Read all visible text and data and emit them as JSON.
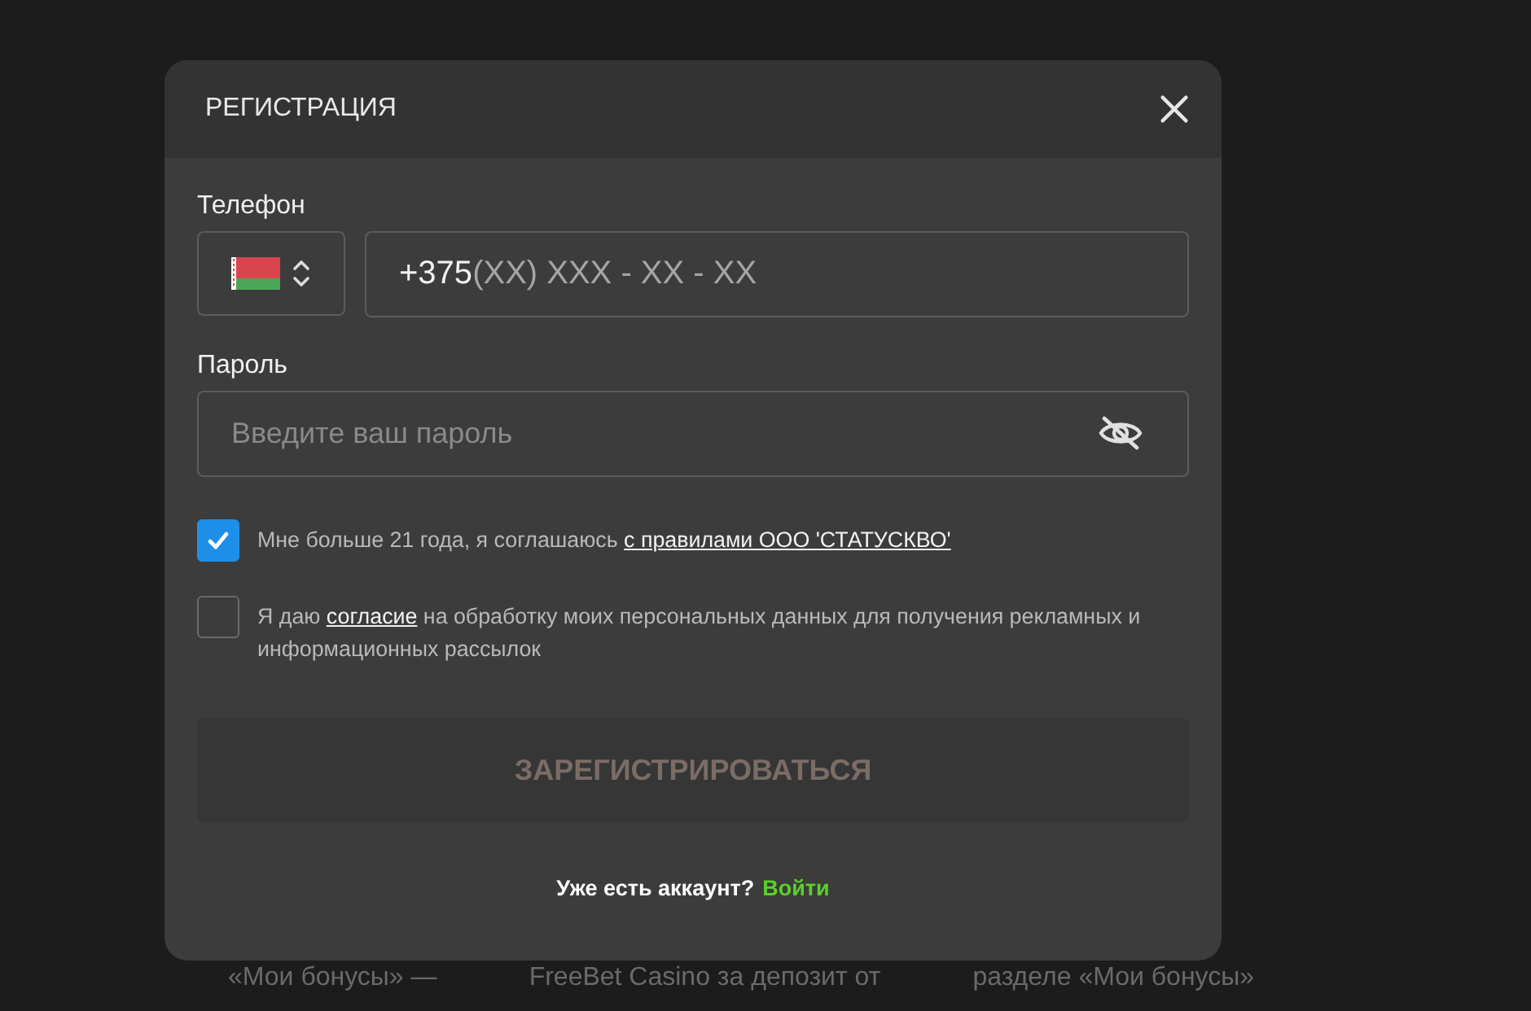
{
  "background": {
    "columns": [
      {
        "text": "«Мои бонусы» —"
      },
      {
        "text": "FreeBet Casino за депозит от"
      },
      {
        "text": "разделе «Мои бонусы»"
      }
    ]
  },
  "dialog": {
    "title": "РЕГИСТРАЦИЯ",
    "phone": {
      "label": "Телефон",
      "value": "+375",
      "mask": "(XX) XXX - XX - XX"
    },
    "password": {
      "label": "Пароль",
      "placeholder": "Введите ваш пароль"
    },
    "agreements": [
      {
        "checked": true,
        "before": "Мне больше 21 года, я соглашаюсь ",
        "link": "с правилами ООО 'СТАТУСКВО'"
      },
      {
        "checked": false,
        "before": "Я даю ",
        "link": "согласие",
        "after": " на обработку моих персональных данных для получения рекламных и информационных рассылок"
      }
    ],
    "submit": {
      "label": "ЗАРЕГИСТРИРОВАТЬСЯ",
      "disabled": true
    },
    "footer": {
      "text": "Уже есть аккаунт?",
      "link": "Войти"
    }
  }
}
